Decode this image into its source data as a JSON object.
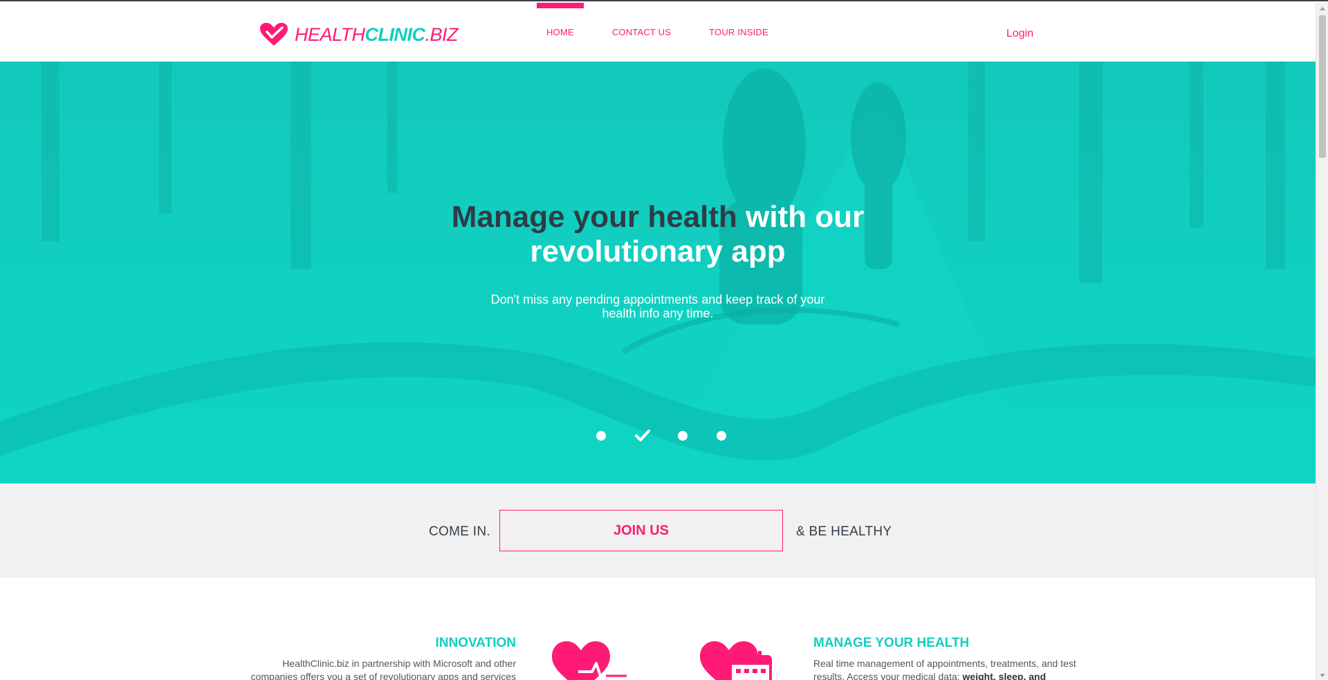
{
  "header": {
    "logo": {
      "part1": "HEALTH",
      "part2": "CLINIC",
      "part3": ".BIZ"
    },
    "nav": [
      {
        "label": "HOME",
        "active": true
      },
      {
        "label": "CONTACT US",
        "active": false
      },
      {
        "label": "TOUR INSIDE",
        "active": false
      }
    ],
    "login_label": "Login"
  },
  "hero": {
    "title_dark": "Manage your health",
    "title_light_1": " with our",
    "title_light_2": "revolutionary app",
    "subtitle": "Don't miss any pending appointments and keep track of your health info any time.",
    "slides_total": 4,
    "current_slide": 2
  },
  "join": {
    "left_text": "COME IN.",
    "button_label": "JOIN US",
    "right_text": "& BE HEALTHY"
  },
  "features": {
    "left": {
      "title": "INNOVATION",
      "text": "HealthClinic.biz in partnership with Microsoft and other companies offers you a set of revolutionary apps and services"
    },
    "right": {
      "title": "MANAGE YOUR HEALTH",
      "text": "Real time management of appointments, treatments, and test results. Access your medical data: ",
      "text_bold": "weight, sleep, and"
    },
    "icons": [
      "heart-pulse-icon",
      "heart-calendar-icon"
    ]
  },
  "colors": {
    "brand_pink": "#ff1a75",
    "brand_teal": "#11cfc0",
    "hero_bg": "#0fcfc0",
    "dark_text": "#2f3c47",
    "strip_bg": "#f1f1f1"
  }
}
